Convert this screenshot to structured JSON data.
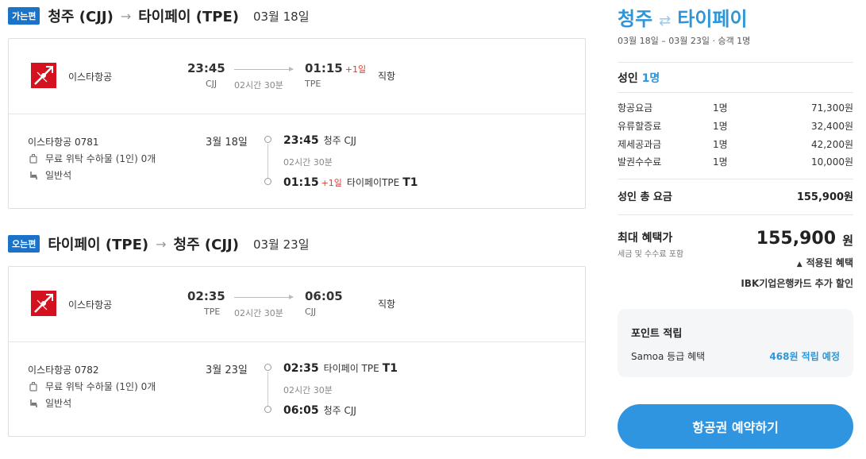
{
  "outbound": {
    "badge": "가는편",
    "from": "청주 (CJJ)",
    "to": "타이페이 (TPE)",
    "date": "03월 18일",
    "summary": {
      "airline": "이스타항공",
      "dep_time": "23:45",
      "dep_code": "CJJ",
      "arr_time": "01:15",
      "arr_plus": "+1일",
      "arr_code": "TPE",
      "duration": "02시간 30분",
      "type": "직항"
    },
    "detail": {
      "flight_no": "이스타항공 0781",
      "baggage": "무료 위탁 수하물 (1인) 0개",
      "cabin": "일반석",
      "date": "3월 18일",
      "dep_time": "23:45",
      "dep_place": "청주 CJJ",
      "duration": "02시간 30분",
      "arr_time": "01:15",
      "arr_plus": "+1일",
      "arr_place": "타이페이TPE",
      "arr_terminal": "T1"
    }
  },
  "inbound": {
    "badge": "오는편",
    "from": "타이페이 (TPE)",
    "to": "청주 (CJJ)",
    "date": "03월 23일",
    "summary": {
      "airline": "이스타항공",
      "dep_time": "02:35",
      "dep_code": "TPE",
      "arr_time": "06:05",
      "arr_code": "CJJ",
      "duration": "02시간 30분",
      "type": "직항"
    },
    "detail": {
      "flight_no": "이스타항공 0782",
      "baggage": "무료 위탁 수하물 (1인) 0개",
      "cabin": "일반석",
      "date": "3월 23일",
      "dep_time": "02:35",
      "dep_place": "타이페이 TPE",
      "dep_terminal": "T1",
      "duration": "02시간 30분",
      "arr_time": "06:05",
      "arr_place": "청주 CJJ"
    }
  },
  "summary_panel": {
    "from": "청주",
    "to": "타이페이",
    "swap_icon": "⇄",
    "subtitle": "03월 18일 – 03월 23일 · 승객 1명",
    "adult_label": "성인",
    "adult_count": "1명",
    "fares": [
      {
        "name": "항공요금",
        "qty": "1명",
        "amount": "71,300원"
      },
      {
        "name": "유류할증료",
        "qty": "1명",
        "amount": "32,400원"
      },
      {
        "name": "제세공과금",
        "qty": "1명",
        "amount": "42,200원"
      },
      {
        "name": "발권수수료",
        "qty": "1명",
        "amount": "10,000원"
      }
    ],
    "total_label": "성인 총 요금",
    "total_amount": "155,900원",
    "max_label": "최대 혜택가",
    "max_sub": "세금 및 수수료 포함",
    "max_price": "155,900",
    "max_unit": "원",
    "benefit_toggle": "적용된 혜택",
    "benefit_item": "IBK기업은행카드 추가 할인",
    "points": {
      "title": "포인트 적립",
      "label": "Samoa 등급 혜택",
      "value": "468원 적립 예정"
    },
    "book_button": "항공권 예약하기"
  },
  "colors": {
    "accent": "#2f95d6",
    "badge": "#1a73c8",
    "plus_day": "#d93b30",
    "airline_logo": "#d4121f"
  }
}
